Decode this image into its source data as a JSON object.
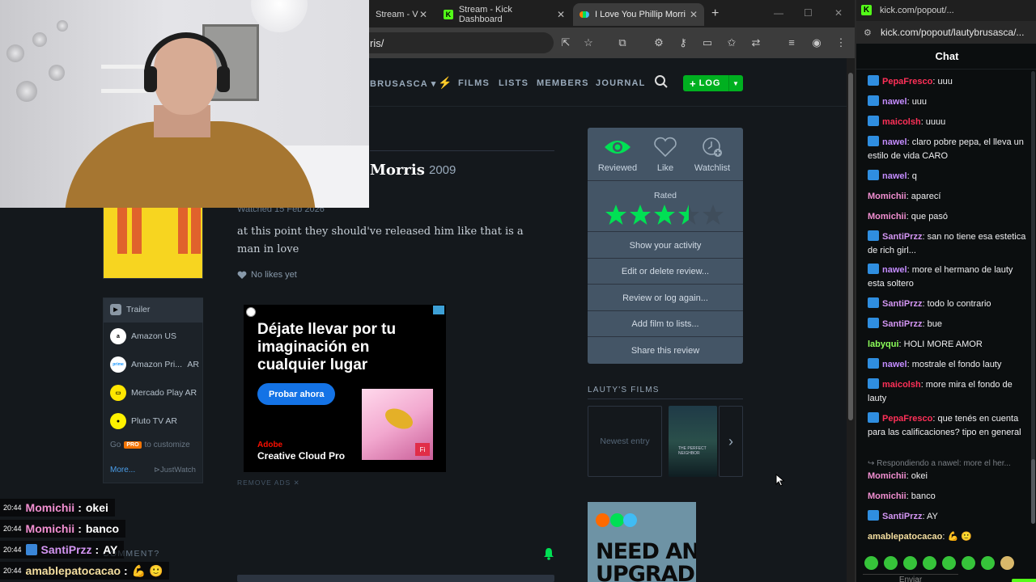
{
  "browser": {
    "tabs": [
      {
        "label": "Stream - V"
      },
      {
        "label": "Stream - Kick Dashboard"
      },
      {
        "label": "I Love You Phillip Morri"
      }
    ],
    "url_fragment": "ris/"
  },
  "letterboxd": {
    "nav": {
      "user": "BRUSASCA",
      "films": "FILMS",
      "lists": "LISTS",
      "members": "MEMBERS",
      "journal": "JOURNAL",
      "log_button": "LOG"
    },
    "film": {
      "title": "Morris",
      "year": "2009"
    },
    "review": {
      "watched": "Watched 15 Feb 2026",
      "text": "at this point they should've released him like that is a man in love",
      "likes": "No likes yet"
    },
    "services": {
      "items": [
        {
          "label": "Trailer",
          "extra": ""
        },
        {
          "label": "Amazon US",
          "extra": ""
        },
        {
          "label": "Amazon Pri...",
          "extra": "AR"
        },
        {
          "label": "Mercado Play AR",
          "extra": ""
        },
        {
          "label": "Pluto TV AR",
          "extra": ""
        }
      ],
      "go_pro_prefix": "Go",
      "pro_badge": "PRO",
      "go_pro_suffix": "to customize",
      "more": "More...",
      "justwatch": "JustWatch"
    },
    "ad": {
      "headline": "Déjate llevar por tu imaginación en cualquier lugar",
      "button": "Probar ahora",
      "brand_line1": "Adobe",
      "brand_line2": "Creative Cloud Pro",
      "badge": "Fi",
      "remove_ads": "REMOVE ADS ✕"
    },
    "actions": {
      "reviewed": "Reviewed",
      "like": "Like",
      "watchlist": "Watchlist",
      "rated": "Rated",
      "rating": 3.5,
      "rating_max": 5,
      "rows": [
        "Show your activity",
        "Edit or delete review...",
        "Review or log again...",
        "Add film to lists...",
        "Share this review"
      ],
      "accent": "#00e054"
    },
    "films_section": {
      "title": "LAUTY'S FILMS",
      "newest": "Newest entry",
      "poster_text": "THE PERFECT NEIGHBOR"
    },
    "ad2": {
      "text": "NEED AN UPGRADE?"
    },
    "comment_label": "COMMENT?"
  },
  "stream_overlay": [
    {
      "time": "20:44",
      "name": "Momichii",
      "msg": "okei",
      "color": "#f28fd1",
      "badge": false
    },
    {
      "time": "20:44",
      "name": "Momichii",
      "msg": "banco",
      "color": "#f28fd1",
      "badge": false
    },
    {
      "time": "20:44",
      "name": "SantiPrzz",
      "msg": "AY",
      "color": "#d395f2",
      "badge": true
    },
    {
      "time": "20:44",
      "name": "amablepatocacao",
      "msg": "💪 🙂",
      "color": "#f5dfa0",
      "badge": false
    }
  ],
  "kick": {
    "window_url": "kick.com/popout/...",
    "url": "kick.com/popout/lautybrusasca/...",
    "chat_title": "Chat",
    "messages": [
      {
        "name": "PepaFresco",
        "text": "uuu",
        "color": "#ff3058",
        "badge": true
      },
      {
        "name": "nawel",
        "text": "uuu",
        "color": "#c48cff",
        "badge": true
      },
      {
        "name": "maicolsh",
        "text": "uuuu",
        "color": "#ff3058",
        "badge": true
      },
      {
        "name": "nawel",
        "text": "claro pobre pepa, el lleva un estilo de vida CARO",
        "color": "#c48cff",
        "badge": true
      },
      {
        "name": "nawel",
        "text": "q",
        "color": "#c48cff",
        "badge": true
      },
      {
        "name": "Momichii",
        "text": "aparecí",
        "color": "#f28fd1",
        "badge": false
      },
      {
        "name": "Momichii",
        "text": "que pasó",
        "color": "#f28fd1",
        "badge": false
      },
      {
        "name": "SantiPrzz",
        "text": "san no tiene esa estetica de rich girl...",
        "color": "#d395f2",
        "badge": true
      },
      {
        "name": "nawel",
        "text": "more el hermano de lauty esta soltero",
        "color": "#c48cff",
        "badge": true
      },
      {
        "name": "SantiPrzz",
        "text": "todo lo contrario",
        "color": "#d395f2",
        "badge": true
      },
      {
        "name": "SantiPrzz",
        "text": "bue",
        "color": "#d395f2",
        "badge": true
      },
      {
        "name": "labyqui",
        "text": "HOLI MORE AMOR",
        "color": "#8cff5a",
        "badge": false
      },
      {
        "name": "nawel",
        "text": "mostrale el fondo lauty",
        "color": "#c48cff",
        "badge": true
      },
      {
        "name": "maicolsh",
        "text": "more mira el fondo de lauty",
        "color": "#ff3058",
        "badge": true
      },
      {
        "name": "PepaFresco",
        "text": "que tenés en cuenta para las calificaciones? tipo en general",
        "color": "#ff3058",
        "badge": true
      },
      {
        "name": "Momichii",
        "text": "okei",
        "color": "#f28fd1",
        "badge": false
      },
      {
        "name": "Momichii",
        "text": "banco",
        "color": "#f28fd1",
        "badge": false
      },
      {
        "name": "SantiPrzz",
        "text": "AY",
        "color": "#d395f2",
        "badge": true
      },
      {
        "name": "amablepatocacao",
        "text": "💪 🙂",
        "color": "#f5dfa0",
        "badge": false
      }
    ],
    "reply_hint": "↪ Respondiendo a nawel: more el her...",
    "send_label": "Enviar"
  }
}
